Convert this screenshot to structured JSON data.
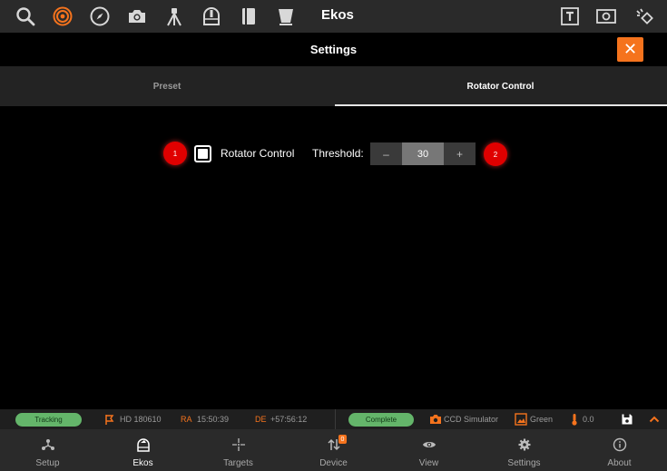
{
  "app": {
    "title": "Ekos"
  },
  "settings": {
    "title": "Settings",
    "close_glyph": "✕"
  },
  "tabs": [
    {
      "label": "Preset"
    },
    {
      "label": "Rotator Control",
      "active": true
    }
  ],
  "rotator": {
    "badge1": "1",
    "badge2": "2",
    "checkbox_label": "Rotator Control",
    "checked": true,
    "threshold_label": "Threshold:",
    "threshold_value": "30",
    "decrement": "–",
    "increment": "+"
  },
  "status": {
    "tracking": "Tracking",
    "target": "HD 180610",
    "ra_label": "RA",
    "ra_value": "15:50:39",
    "de_label": "DE",
    "de_value": "+57:56:12",
    "capture_state": "Complete",
    "camera": "CCD Simulator",
    "filter": "Green",
    "temperature": "0.0"
  },
  "nav": [
    {
      "label": "Setup",
      "icon": "setup-icon"
    },
    {
      "label": "Ekos",
      "icon": "ekos-icon",
      "active": true
    },
    {
      "label": "Targets",
      "icon": "targets-icon"
    },
    {
      "label": "Device",
      "icon": "device-icon",
      "badge": "0"
    },
    {
      "label": "View",
      "icon": "view-icon"
    },
    {
      "label": "Settings",
      "icon": "settings-icon"
    },
    {
      "label": "About",
      "icon": "about-icon"
    }
  ],
  "colors": {
    "accent": "#f5731d",
    "status_ok": "#64b56a",
    "badge_red": "#e00000",
    "topbar": "#2a2a2a"
  }
}
